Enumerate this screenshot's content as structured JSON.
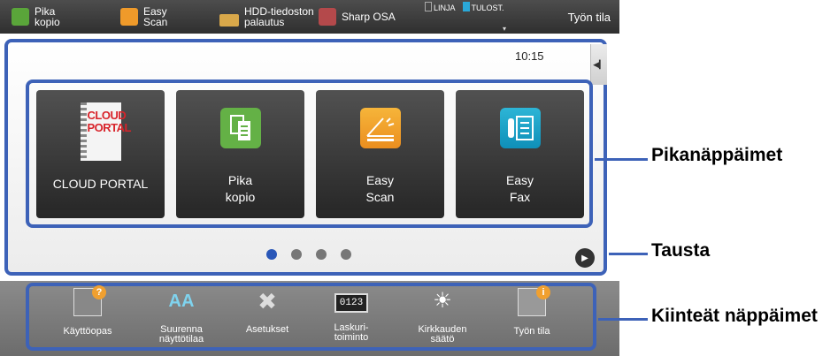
{
  "topbar": {
    "items": [
      {
        "label": "Pika\nkopio",
        "icon": "pika-kopio-icon"
      },
      {
        "label": "Easy\nScan",
        "icon": "easy-scan-icon"
      },
      {
        "label": "HDD-tiedoston\npalautus",
        "icon": "folder-icon"
      },
      {
        "label": "Sharp OSA",
        "icon": "sharp-osa-icon"
      }
    ],
    "status_linja": "LINJA",
    "status_tulost": "TULOST.",
    "dropdown_glyph": "▾",
    "job_status_label": "Työn tila"
  },
  "main": {
    "time": "10:15",
    "side_tab_glyph": "◀▎",
    "keys": [
      {
        "label": "CLOUD PORTAL",
        "icon": "cloud-portal-icon",
        "icon_text_1": "CLOUD",
        "icon_text_2": "PORTAL"
      },
      {
        "label": "Pika\nkopio",
        "icon": "pika-kopio-icon"
      },
      {
        "label": "Easy\nScan",
        "icon": "easy-scan-icon"
      },
      {
        "label": "Easy\nFax",
        "icon": "easy-fax-icon"
      }
    ],
    "page_count": 4,
    "active_page": 1,
    "next_glyph": "▶"
  },
  "fixed_keys": [
    {
      "label": "Käyttöopas",
      "icon": "user-guide-icon"
    },
    {
      "label": "Suurenna\nnäyttötilaa",
      "icon": "enlarge-display-icon",
      "icon_text": "AA"
    },
    {
      "label": "Asetukset",
      "icon": "settings-icon"
    },
    {
      "label": "Laskuri-\ntoiminto",
      "icon": "counter-icon",
      "icon_text": "0123"
    },
    {
      "label": "Kirkkauden\nsäätö",
      "icon": "brightness-icon"
    },
    {
      "label": "Työn tila",
      "icon": "job-status-icon"
    }
  ],
  "callouts": {
    "shortcut_keys": "Pikanäppäimet",
    "background": "Tausta",
    "fixed_keys": "Kiinteät näppäimet"
  },
  "colors": {
    "accent_frame": "#3d62b8",
    "key_bg": "#333333",
    "pika_green": "#64b146",
    "scan_orange": "#eb8e1f",
    "fax_blue": "#0f8fb8"
  }
}
